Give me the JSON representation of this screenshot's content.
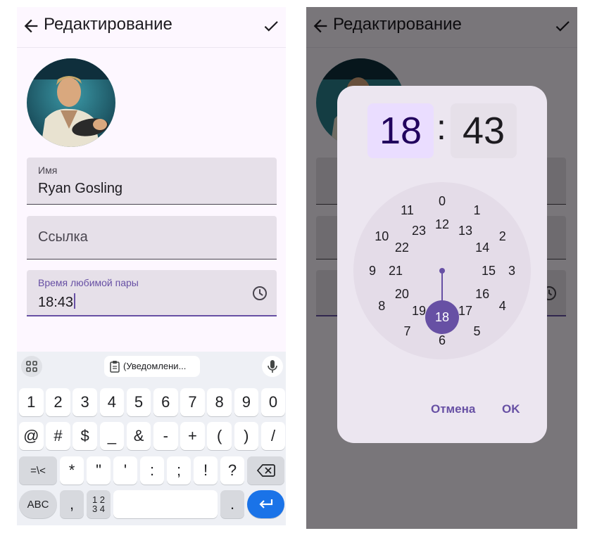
{
  "edit_screen": {
    "title": "Редактирование",
    "fields": {
      "name": {
        "label": "Имя",
        "value": "Ryan Gosling"
      },
      "link": {
        "placeholder": "Ссылка"
      },
      "time": {
        "label": "Время любимой пары",
        "value": "18:43"
      }
    },
    "keyboard": {
      "clipboard": "(Уведомлени...",
      "row_digits": [
        "1",
        "2",
        "3",
        "4",
        "5",
        "6",
        "7",
        "8",
        "9",
        "0"
      ],
      "row_symbols": [
        "@",
        "#",
        "$",
        "_",
        "&",
        "-",
        "+",
        "(",
        ")",
        "/"
      ],
      "row_third": [
        "=\\<",
        "*",
        "\"",
        "'",
        ":",
        ";",
        "!",
        "?"
      ],
      "abc": "ABC",
      "comma": ",",
      "numpad": "1 2\n3 4",
      "period": "."
    }
  },
  "time_picker": {
    "hour": "18",
    "separator": ":",
    "minute": "43",
    "outer_ring": [
      "0",
      "1",
      "2",
      "3",
      "4",
      "5",
      "6",
      "7",
      "8",
      "9",
      "10",
      "11"
    ],
    "inner_ring": [
      "12",
      "13",
      "14",
      "15",
      "16",
      "17",
      "18",
      "19",
      "20",
      "21",
      "22",
      "23"
    ],
    "selected": "18",
    "cancel": "Отмена",
    "ok": "OK"
  },
  "colors": {
    "primary": "#6750a4",
    "field_bg": "#e6e0e9",
    "surface": "#fdf7ff",
    "enter_key": "#1a73e8"
  }
}
